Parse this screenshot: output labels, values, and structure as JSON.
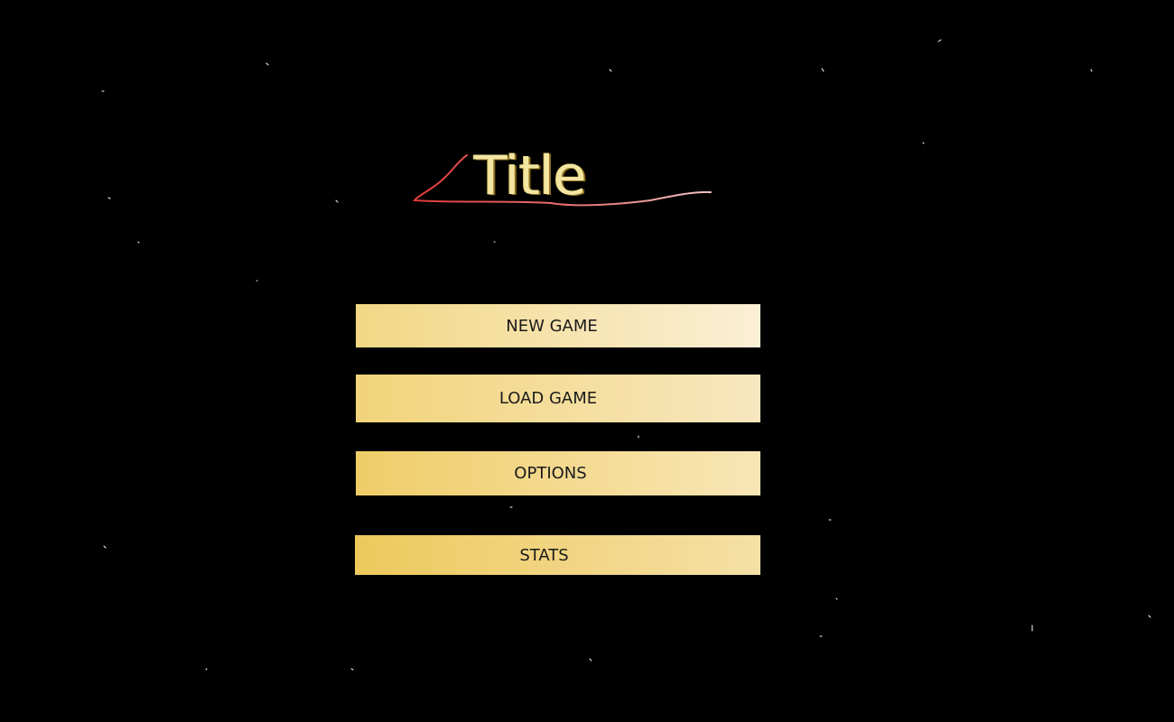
{
  "title": {
    "text": "Title",
    "color": "#f3e6a0",
    "underline_color": "#e03a3a"
  },
  "menu": {
    "items": [
      {
        "id": "new-game",
        "label": "NEW GAME"
      },
      {
        "id": "load-game",
        "label": "LOAD GAME"
      },
      {
        "id": "options",
        "label": "OPTIONS"
      },
      {
        "id": "stats",
        "label": "STATS"
      }
    ],
    "button_color": "#f1d784",
    "label_color": "#1a1a1a"
  },
  "background": {
    "color": "#000000",
    "decoration": "starfield"
  }
}
